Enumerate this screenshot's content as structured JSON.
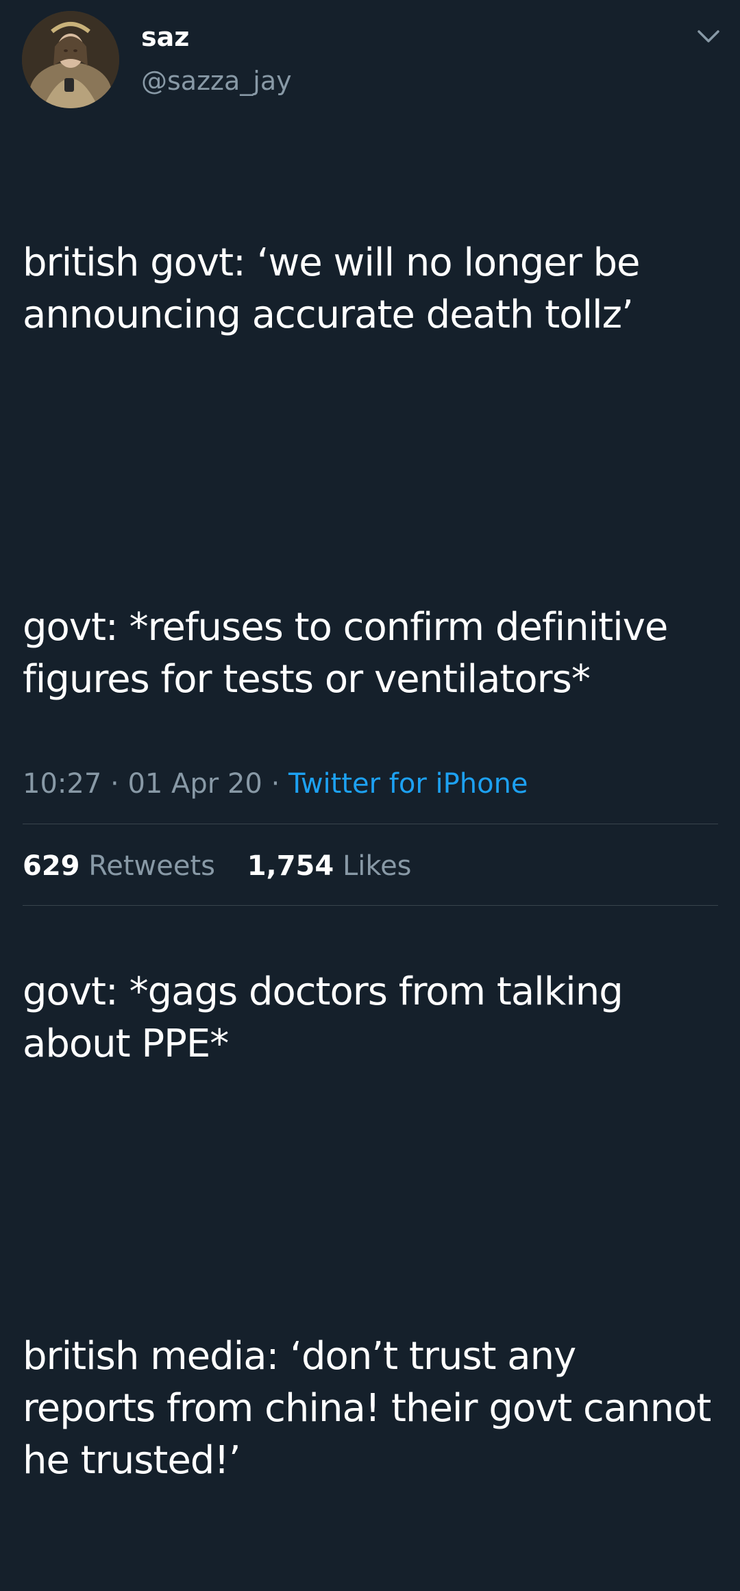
{
  "tweet": {
    "author": {
      "display_name": "saz",
      "handle": "@sazza_jay",
      "avatar_icon": "profile-photo"
    },
    "menu_icon": "chevron-down-icon",
    "paragraphs": [
      "british govt: ‘we will no longer be announcing accurate death tollz’",
      "govt: *refuses to confirm definitive figures for tests or ventilators*",
      "govt: *gags doctors from talking about PPE*",
      "british media: ‘don’t trust any reports from china! their govt cannot he trusted!’"
    ],
    "meta": {
      "time": "10:27",
      "separator": "·",
      "date": "01 Apr 20",
      "source": "Twitter for iPhone"
    },
    "stats": {
      "retweets_count": "629",
      "retweets_label": "Retweets",
      "likes_count": "1,754",
      "likes_label": "Likes"
    }
  },
  "colors": {
    "background": "#15202b",
    "primary_text": "#ffffff",
    "secondary_text": "#8899a6",
    "link": "#1da1f2",
    "divider": "#38444d"
  }
}
